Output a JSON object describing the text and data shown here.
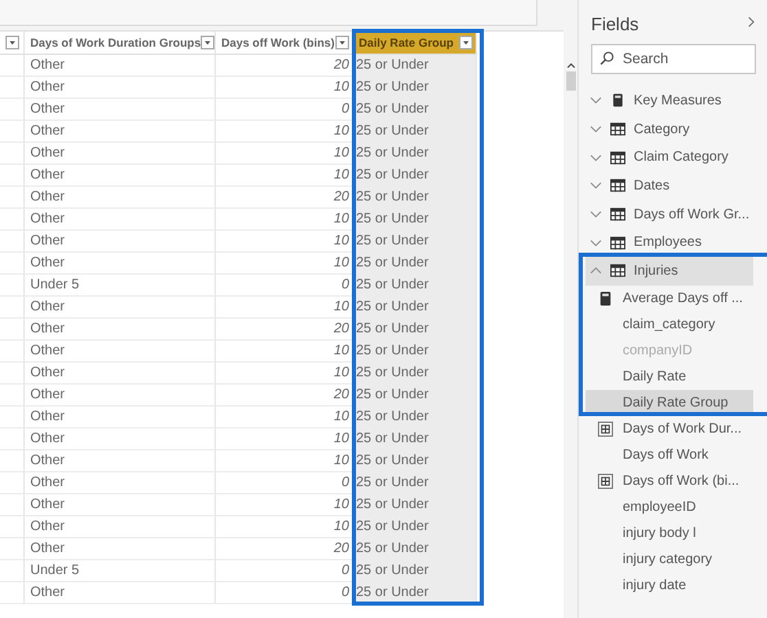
{
  "table": {
    "columns": [
      {
        "label": "Days of Work Duration Groups",
        "selected": false
      },
      {
        "label": "Days off Work (bins)",
        "selected": false
      },
      {
        "label": "Daily Rate Group",
        "selected": true
      }
    ],
    "rows": [
      {
        "group": "Other",
        "bins": "20",
        "rate": "25 or Under"
      },
      {
        "group": "Other",
        "bins": "10",
        "rate": "25 or Under"
      },
      {
        "group": "Other",
        "bins": "0",
        "rate": "25 or Under"
      },
      {
        "group": "Other",
        "bins": "10",
        "rate": "25 or Under"
      },
      {
        "group": "Other",
        "bins": "10",
        "rate": "25 or Under"
      },
      {
        "group": "Other",
        "bins": "10",
        "rate": "25 or Under"
      },
      {
        "group": "Other",
        "bins": "20",
        "rate": "25 or Under"
      },
      {
        "group": "Other",
        "bins": "10",
        "rate": "25 or Under"
      },
      {
        "group": "Other",
        "bins": "10",
        "rate": "25 or Under"
      },
      {
        "group": "Other",
        "bins": "10",
        "rate": "25 or Under"
      },
      {
        "group": "Under 5",
        "bins": "0",
        "rate": "25 or Under"
      },
      {
        "group": "Other",
        "bins": "10",
        "rate": "25 or Under"
      },
      {
        "group": "Other",
        "bins": "20",
        "rate": "25 or Under"
      },
      {
        "group": "Other",
        "bins": "10",
        "rate": "25 or Under"
      },
      {
        "group": "Other",
        "bins": "10",
        "rate": "25 or Under"
      },
      {
        "group": "Other",
        "bins": "20",
        "rate": "25 or Under"
      },
      {
        "group": "Other",
        "bins": "10",
        "rate": "25 or Under"
      },
      {
        "group": "Other",
        "bins": "10",
        "rate": "25 or Under"
      },
      {
        "group": "Other",
        "bins": "10",
        "rate": "25 or Under"
      },
      {
        "group": "Other",
        "bins": "0",
        "rate": "25 or Under"
      },
      {
        "group": "Other",
        "bins": "10",
        "rate": "25 or Under"
      },
      {
        "group": "Other",
        "bins": "10",
        "rate": "25 or Under"
      },
      {
        "group": "Other",
        "bins": "20",
        "rate": "25 or Under"
      },
      {
        "group": "Under 5",
        "bins": "0",
        "rate": "25 or Under"
      },
      {
        "group": "Other",
        "bins": "0",
        "rate": "25 or Under"
      }
    ]
  },
  "fields": {
    "title": "Fields",
    "search": {
      "placeholder": "Search"
    },
    "tables": [
      {
        "name": "Key Measures",
        "kind": "measures",
        "expanded": false,
        "selected": false
      },
      {
        "name": "Category",
        "kind": "table",
        "expanded": false,
        "selected": false
      },
      {
        "name": "Claim Category",
        "kind": "table",
        "expanded": false,
        "selected": false
      },
      {
        "name": "Dates",
        "kind": "table",
        "expanded": false,
        "selected": false
      },
      {
        "name": "Days off Work Gr...",
        "kind": "table",
        "expanded": false,
        "selected": false
      },
      {
        "name": "Employees",
        "kind": "table",
        "expanded": false,
        "selected": false
      },
      {
        "name": "Injuries",
        "kind": "table",
        "expanded": true,
        "selected": true,
        "children": [
          {
            "name": "Average Days off ...",
            "kind": "measure",
            "hidden": false,
            "selected": false
          },
          {
            "name": "claim_category",
            "kind": "column",
            "hidden": false,
            "selected": false
          },
          {
            "name": "companyID",
            "kind": "column",
            "hidden": true,
            "selected": false
          },
          {
            "name": "Daily Rate",
            "kind": "column",
            "hidden": false,
            "selected": false
          },
          {
            "name": "Daily Rate Group",
            "kind": "column",
            "hidden": false,
            "selected": true
          },
          {
            "name": "Days of Work Dur...",
            "kind": "group",
            "hidden": false,
            "selected": false
          },
          {
            "name": "Days off Work",
            "kind": "column",
            "hidden": false,
            "selected": false
          },
          {
            "name": "Days off Work (bi...",
            "kind": "group",
            "hidden": false,
            "selected": false
          },
          {
            "name": "employeeID",
            "kind": "column",
            "hidden": false,
            "selected": false
          },
          {
            "name": "injury body l",
            "kind": "column",
            "hidden": false,
            "selected": false
          },
          {
            "name": "injury category",
            "kind": "column",
            "hidden": false,
            "selected": false
          },
          {
            "name": "injury date",
            "kind": "column",
            "hidden": false,
            "selected": false
          }
        ]
      }
    ]
  }
}
